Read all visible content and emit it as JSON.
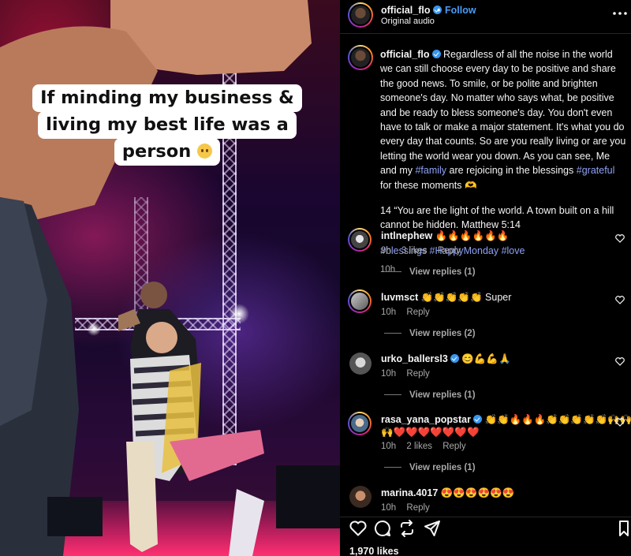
{
  "video": {
    "caption_lines": [
      "If minding my business &",
      "living my best life was a",
      "person"
    ]
  },
  "header": {
    "username": "official_flo",
    "separator": "•",
    "follow_label": "Follow",
    "audio": "Original audio"
  },
  "post": {
    "username": "official_flo",
    "paragraph1_a": "Regardless of all the noise in the world we can still choose every day to be positive and share the good news. To smile, or be polite and brighten someone's day. No matter who says what, be positive and be ready to bless someone's day. You don't even have to talk or make a major statement. It's what you do every day that counts. So are you really living or are you letting the world wear you down. As you can see, Me and my ",
    "hashtag_family": "#family",
    "paragraph1_b": " are rejoicing in the blessings ",
    "hashtag_grateful": "#grateful",
    "paragraph1_c": " for these moments 🫶",
    "paragraph2": "14 “You are the light of the world. A town built on a hill cannot be hidden. Matthew 5:14",
    "hashtags": "#blessings #HappyMonday #love",
    "time": "10h"
  },
  "comments": [
    {
      "username": "intlnephew",
      "text": "🔥🔥🔥🔥🔥🔥",
      "time": "9h",
      "likes": "3 likes",
      "reply": "Reply",
      "view_replies": "View replies (1)",
      "verified": false
    },
    {
      "username": "luvmsct",
      "text": "👏👏👏👏👏 Super",
      "time": "10h",
      "likes": "",
      "reply": "Reply",
      "view_replies": "View replies (2)",
      "verified": false
    },
    {
      "username": "urko_ballersl3",
      "text": "😊💪💪🙏",
      "time": "10h",
      "likes": "",
      "reply": "Reply",
      "view_replies": "View replies (1)",
      "verified": true
    },
    {
      "username": "rasa_yana_popstar",
      "text": "👏👏🔥🔥🔥👏👏👏👏👏🙌🙌",
      "text2": "🙌❤️❤️❤️❤️❤️❤️❤️",
      "time": "10h",
      "likes": "2 likes",
      "reply": "Reply",
      "view_replies": "View replies (1)",
      "verified": true
    },
    {
      "username": "marina.4017",
      "text": "😍😍😍😍😍😍",
      "time": "10h",
      "likes": "",
      "reply": "Reply",
      "view_replies": "",
      "verified": false
    }
  ],
  "footer": {
    "likes": "1,970 likes"
  },
  "colors": {
    "link": "#8ea1f5",
    "follow": "#4a9bf5",
    "verified": "#3897f0"
  }
}
